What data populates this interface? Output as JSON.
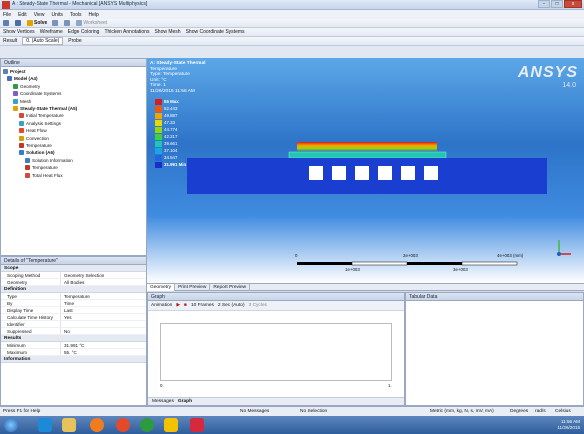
{
  "window": {
    "title": "A : Steady-State Thermal - Mechanical [ANSYS Multiphysics]",
    "buttons": [
      "-",
      "□",
      "x"
    ]
  },
  "menu": [
    "File",
    "Edit",
    "View",
    "Units",
    "Tools",
    "Help"
  ],
  "toolbar1": {
    "solve": "Solve",
    "worksheet": "Worksheet"
  },
  "toolbar2": {
    "show_vertices": "Show Vertices",
    "wireframe": "Wireframe",
    "edge_coloring": "Edge Coloring",
    "thicken": "Thicken Annotations",
    "show_mesh": "Show Mesh",
    "show_coords": "Show Coordinate Systems"
  },
  "toolbar3": {
    "result": "Result",
    "result_value": "0. (Auto Scale)",
    "probe": "Probe"
  },
  "outline": {
    "header": "Outline",
    "items": [
      {
        "label": "Project",
        "bold": true
      },
      {
        "label": "Model (A4)",
        "bold": true
      },
      {
        "label": "Geometry",
        "bold": false
      },
      {
        "label": "Coordinate Systems",
        "bold": false
      },
      {
        "label": "Mesh",
        "bold": false
      },
      {
        "label": "Steady-State Thermal (A5)",
        "bold": true
      },
      {
        "label": "Initial Temperature",
        "bold": false
      },
      {
        "label": "Analysis Settings",
        "bold": false
      },
      {
        "label": "Heat Flow",
        "bold": false
      },
      {
        "label": "Convection",
        "bold": false
      },
      {
        "label": "Temperature",
        "bold": false
      },
      {
        "label": "Solution (A6)",
        "bold": true
      },
      {
        "label": "Solution Information",
        "bold": false
      },
      {
        "label": "Temperature",
        "bold": false
      },
      {
        "label": "Total Heat Flux",
        "bold": false
      }
    ]
  },
  "details": {
    "header": "Details of \"Temperature\"",
    "scope": {
      "label": "Scope",
      "rows": [
        [
          "Scoping Method",
          "Geometry Selection"
        ],
        [
          "Geometry",
          "All Bodies"
        ]
      ]
    },
    "definition": {
      "label": "Definition",
      "rows": [
        [
          "Type",
          "Temperature"
        ],
        [
          "By",
          "Time"
        ],
        [
          "Display Time",
          "Last"
        ],
        [
          "Calculate Time History",
          "Yes"
        ],
        [
          "Identifier",
          ""
        ],
        [
          "Suppressed",
          "No"
        ]
      ]
    },
    "results": {
      "label": "Results",
      "rows": [
        [
          "Minimum",
          "31.991 °C"
        ],
        [
          "Maximum",
          "55. °C"
        ]
      ]
    },
    "information": {
      "label": "Information"
    }
  },
  "viewport": {
    "name": "A: Steady-State Thermal",
    "lines": [
      "Temperature",
      "Type: Temperature",
      "Unit: °C",
      "Time: 1",
      "11/26/2015 11:56 AM"
    ],
    "legend": [
      "55 Max",
      "52.443",
      "49.887",
      "47.33",
      "44.774",
      "42.217",
      "39.661",
      "37.104",
      "34.547",
      "31.991 Min"
    ],
    "legend_colors": [
      "#d71e1e",
      "#ec5a12",
      "#f4a300",
      "#e6d800",
      "#9bd600",
      "#3fcf3f",
      "#1fc7b2",
      "#18a6e6",
      "#2266dd",
      "#1a2ec7"
    ],
    "logo": "ANSYS",
    "version": "14.0",
    "scale_top": [
      "0",
      "2e+003",
      "4e+003 (mm)"
    ],
    "scale_bottom": [
      "1e+003",
      "3e+003"
    ]
  },
  "tabs": [
    "Geometry",
    "Print Preview",
    "Report Preview"
  ],
  "graph": {
    "header": "Graph",
    "animation": "Animation",
    "frames": "10 Frames",
    "sec": "2 Sec (Auto)",
    "cycles": "3 Cycles",
    "x0": "0.",
    "x1": "1.",
    "tabs": [
      "Messages",
      "Graph"
    ]
  },
  "tabular": {
    "header": "Tabular Data"
  },
  "status": {
    "help": "Press F1 for Help",
    "messages": "No Messages",
    "selection": "No Selection",
    "units": "Metric (mm, kg, N, s, mV, mA)",
    "angle": "Degrees",
    "rad": "rad/s",
    "temp": "Celsius"
  },
  "clock": {
    "time": "11:56 AM",
    "date": "11/26/2015"
  }
}
